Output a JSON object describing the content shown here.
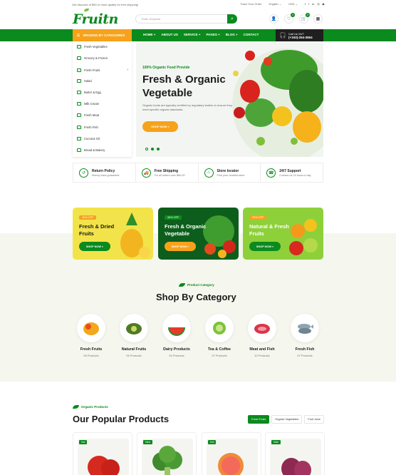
{
  "topbar": {
    "promo": "Get discount of $50 or more qualify for free shipping!",
    "track": "Track Your Order",
    "language": "English",
    "currency": "USD",
    "social": [
      "f",
      "t",
      "in",
      "◎",
      "▶"
    ]
  },
  "header": {
    "logo": "Fruitn",
    "search_placeholder": "Enter Keyword",
    "wishlist_count": "0",
    "cart_count": "0"
  },
  "nav": {
    "browse_label": "BROWSE BY CATEGORIES",
    "items": [
      "HOME +",
      "ABOUT US",
      "SERVICE +",
      "PAGES +",
      "BLOG +",
      "CONTACT"
    ],
    "call_label": "Call Us 24/7",
    "call_number": "(+163)-254-3654"
  },
  "sidebar": {
    "categories": [
      "Fresh Vegetables",
      "Grocery & Frozen",
      "Fresh Fruits",
      "Salad",
      "Butter & Egg",
      "Milk Cream",
      "Fresh Meat",
      "Fresh Fish",
      "Coconut Oil",
      "Bread & Bakery"
    ]
  },
  "hero": {
    "subtitle": "100% Organic Food Provide",
    "title": "Fresh & Organic Vegetable",
    "description": "Organic foods are typically certified by regulatory bodies to ensure they meet specific organic standards.",
    "button": "SHOP NOW »"
  },
  "features": [
    {
      "title": "Return Policy",
      "sub": "Money back guarantee",
      "icon": "return-icon"
    },
    {
      "title": "Free Shipping",
      "sub": "On all orders over $60.00",
      "icon": "truck-icon"
    },
    {
      "title": "Store locator",
      "sub": "Find your nearest store",
      "icon": "store-icon"
    },
    {
      "title": "24/7 Support",
      "sub": "Contact us 24 hours a day",
      "icon": "headset-icon"
    }
  ],
  "promos": [
    {
      "tag": "10% OFF",
      "title": "Fresh & Dried Fruits",
      "button": "SHOP NOW »",
      "bg": "#f3e34a"
    },
    {
      "tag": "30% OFF",
      "title": "Fresh & Organic Vegetable",
      "button": "SHOP NOW »",
      "bg": "#0d5e1c"
    },
    {
      "tag": "20% OFF",
      "title": "Natural & Fresh Fruits",
      "button": "SHOP NOW »",
      "bg": "#8ed03a"
    }
  ],
  "category_section": {
    "tag": "Product Category",
    "title": "Shop By Category",
    "items": [
      {
        "name": "Fresh Fruits",
        "count": "06 Products"
      },
      {
        "name": "Natural Fruits",
        "count": "05 Products"
      },
      {
        "name": "Dairy Products",
        "count": "04 Products"
      },
      {
        "name": "Tea & Coffee",
        "count": "07 Products"
      },
      {
        "name": "Meat and Fish",
        "count": "10 Products"
      },
      {
        "name": "Fresh Fish",
        "count": "07 Products"
      }
    ]
  },
  "products_section": {
    "tag": "Organic Products",
    "title": "Our Popular Products",
    "tabs": [
      "Fresh Fruits",
      "Organic Vegetables",
      "Fruit Juice"
    ],
    "cards": [
      {
        "label": "Hot"
      },
      {
        "label": "New"
      },
      {
        "label": "Hot"
      },
      {
        "label": "Sale"
      }
    ]
  }
}
